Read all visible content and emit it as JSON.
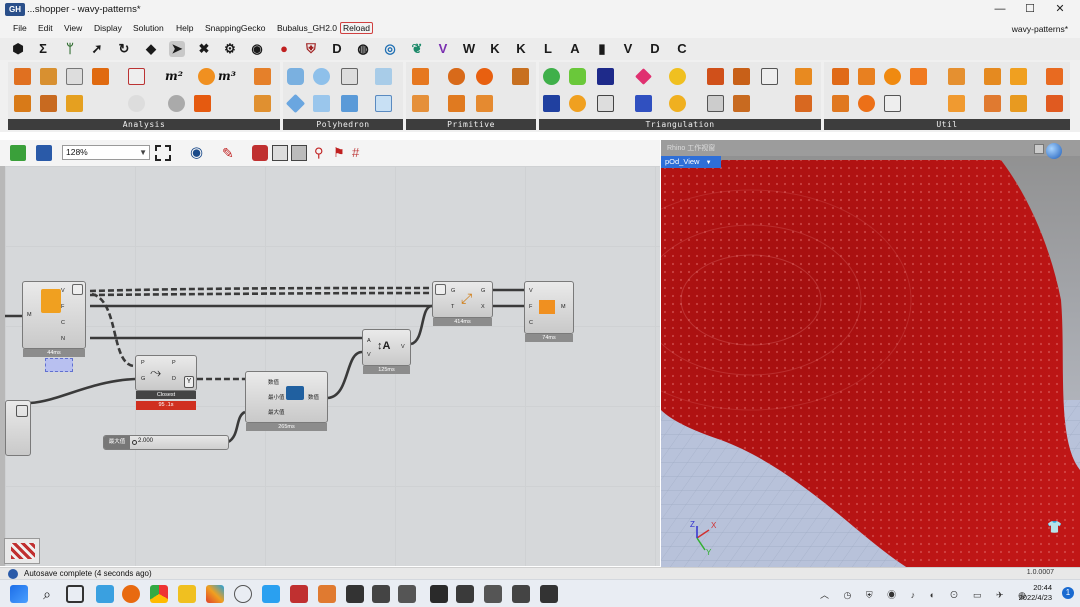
{
  "window": {
    "app_icon_text": "GH",
    "title": "...shopper - wavy-patterns*",
    "doc_name": "wavy-patterns*",
    "minimize": "—",
    "maximize": "☐",
    "close": "✕"
  },
  "menu": {
    "items": [
      "File",
      "Edit",
      "View",
      "Display",
      "Solution",
      "Help",
      "SnappingGecko",
      "Bubalus_GH2.0",
      "Reload"
    ]
  },
  "tabs": {
    "letters": [
      "W",
      "K",
      "K",
      "L",
      "A",
      "V",
      "D",
      "C"
    ]
  },
  "ribbon": {
    "groups": [
      "Analysis",
      "Polyhedron",
      "Primitive",
      "Triangulation",
      "Util"
    ],
    "m2_label": "m²",
    "m3_label": "m³"
  },
  "canvas_toolbar": {
    "zoom": "128%"
  },
  "canvas": {
    "node1": {
      "ports_in": [
        "M"
      ],
      "ports_out": [
        "V",
        "F",
        "C",
        "N"
      ],
      "time": "44ms"
    },
    "closest": {
      "label": "Closest",
      "time": "95 .1s",
      "ports_in": [
        "P",
        "G"
      ],
      "ports_out": [
        "P",
        "D"
      ]
    },
    "remap": {
      "ports_in": [
        "数值",
        "最小值",
        "最大值"
      ],
      "ports_out": [
        "数值"
      ],
      "time": "265ms"
    },
    "move": {
      "ports_in": [
        "A",
        "V"
      ],
      "ports_out": [
        "V"
      ],
      "time": "125ms"
    },
    "graft": {
      "ports_in": [
        "G",
        "T"
      ],
      "ports_out": [
        "G",
        "X"
      ],
      "time": "414ms"
    },
    "mesh": {
      "ports_in": [
        "V",
        "F",
        "C"
      ],
      "ports_out": [
        "M"
      ],
      "time": "74ms"
    },
    "slider": {
      "label": "最大值",
      "value": "2.000"
    }
  },
  "viewport": {
    "title": "Rhino 工作视窗",
    "tab": "pOd_View",
    "axis_x": "X",
    "axis_y": "Y",
    "axis_z": "Z",
    "colors": {
      "mesh": "#b81414",
      "bg": "#b0b4c0"
    }
  },
  "status": {
    "message": "Autosave complete (4 seconds ago)",
    "version": "1.0.0007"
  },
  "taskbar": {
    "time": "20:44",
    "date": "2022/4/23"
  }
}
